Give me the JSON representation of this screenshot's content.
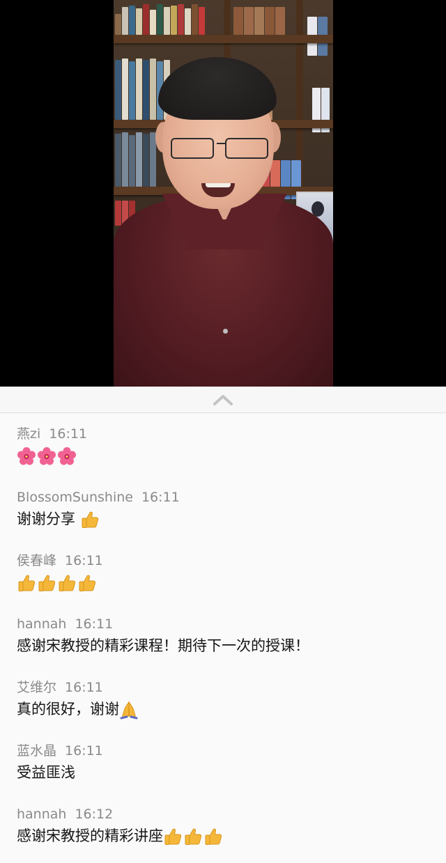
{
  "collapse_control": {
    "icon": "chevron-up-icon"
  },
  "comments": [
    {
      "author": "燕zi",
      "time": "16:11",
      "text": "",
      "emoji": [
        "flower",
        "flower",
        "flower"
      ]
    },
    {
      "author": "BlossomSunshine",
      "time": "16:11",
      "text": "谢谢分享 ",
      "emoji": [
        "thumbs-up"
      ]
    },
    {
      "author": "侯春峰",
      "time": "16:11",
      "text": "",
      "emoji": [
        "thumbs-up",
        "thumbs-up",
        "thumbs-up",
        "thumbs-up"
      ]
    },
    {
      "author": "hannah",
      "time": "16:11",
      "text": "感谢宋教授的精彩课程！期待下一次的授课！",
      "emoji": []
    },
    {
      "author": "艾维尔",
      "time": "16:11",
      "text": "真的很好，谢谢",
      "emoji": [
        "folded-hands"
      ]
    },
    {
      "author": "蓝水晶",
      "time": "16:11",
      "text": "受益匪浅",
      "emoji": []
    },
    {
      "author": "hannah",
      "time": "16:12",
      "text": "感谢宋教授的精彩讲座",
      "emoji": [
        "thumbs-up",
        "thumbs-up",
        "thumbs-up"
      ]
    }
  ],
  "colors": {
    "meta": "#8a8a8a",
    "text": "#151515",
    "background": "#fafafa",
    "video_bg": "#000000"
  }
}
